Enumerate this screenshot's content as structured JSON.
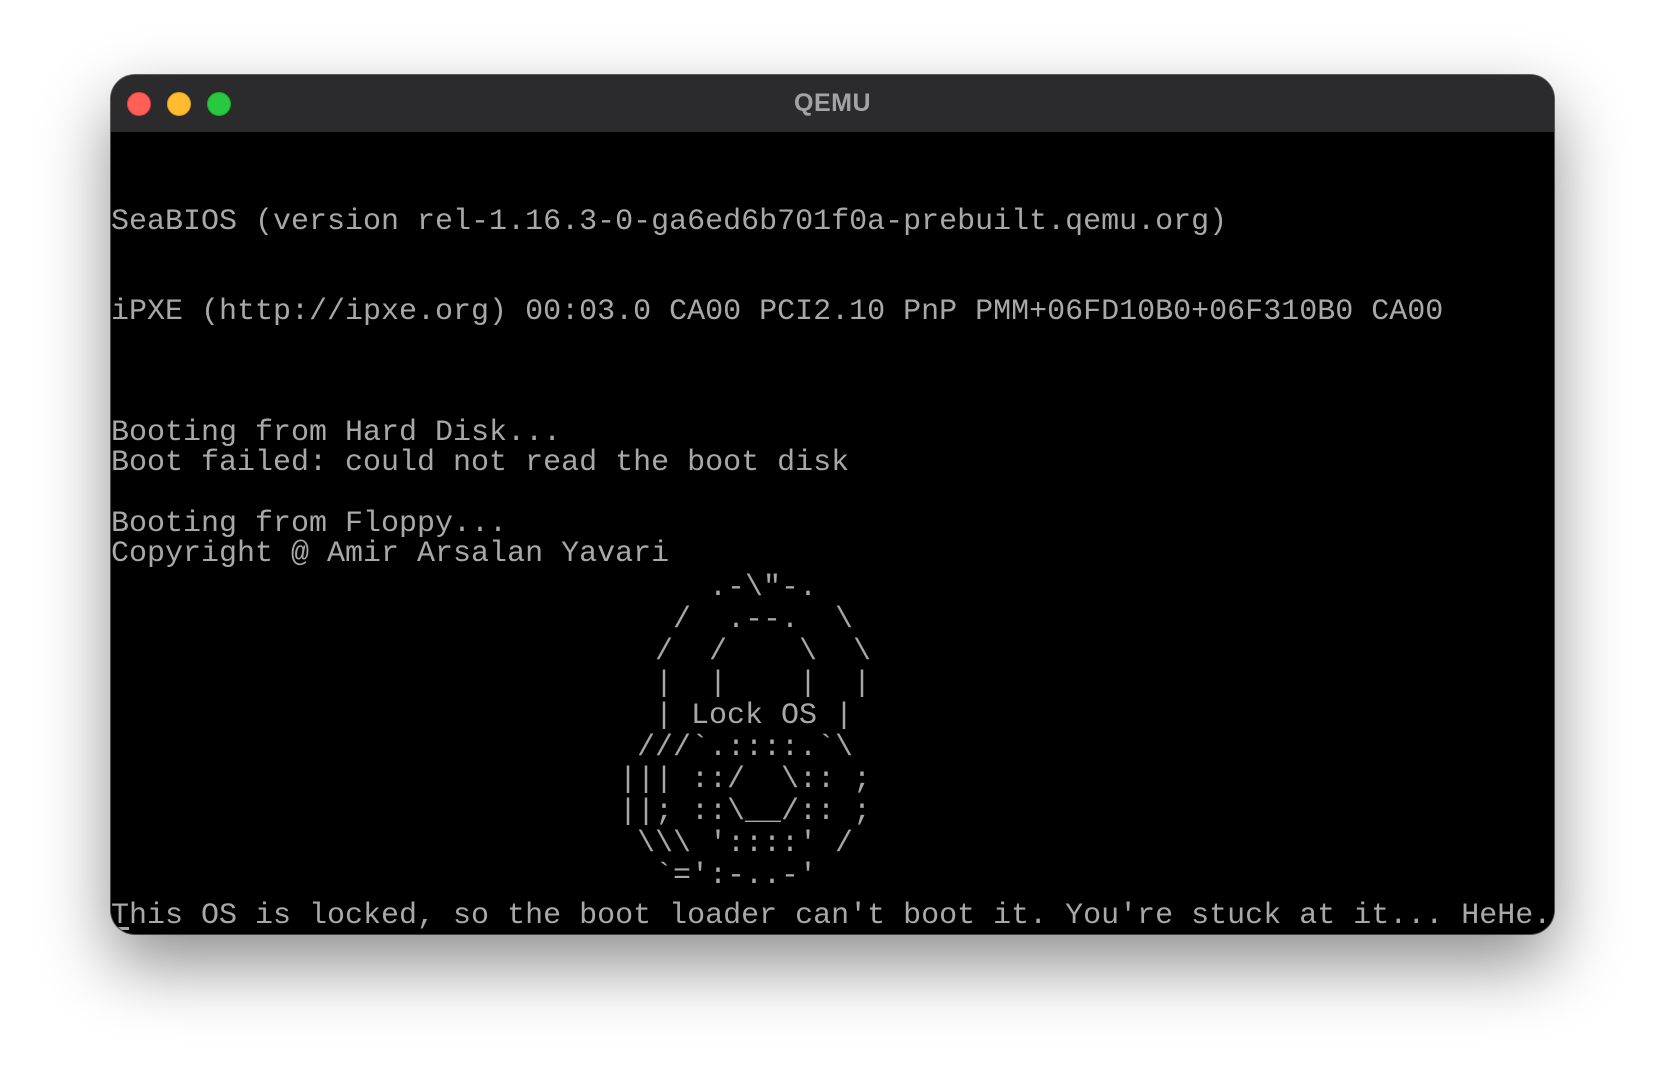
{
  "window": {
    "title": "QEMU"
  },
  "console": {
    "lines": [
      "SeaBIOS (version rel-1.16.3-0-ga6ed6b701f0a-prebuilt.qemu.org)",
      "iPXE (http://ipxe.org) 00:03.0 CA00 PCI2.10 PnP PMM+06FD10B0+06F310B0 CA00",
      "Booting from Hard Disk...",
      "Boot failed: could not read the boot disk",
      "Booting from Floppy...",
      "Copyright @ Amir Arsalan Yavari"
    ],
    "ascii_art": "      .-\\\"-.\n    /  .--.  \\\n   /  /    \\  \\\n   |  |    |  |\n   | Lock OS |\n  ///`.::::.`\\\n ||| ::/  \\:: ;\n ||; ::\\__/:: ;\n  \\\\\\ '::::' /\n   `=':-..-'",
    "message": "This OS is locked, so the boot loader can't boot it. You're stuck at it... HeHe."
  },
  "colors": {
    "text": "#a8a8a8",
    "background": "#000000",
    "titlebar": "#2b2b2d",
    "close": "#fe5f57",
    "minimize": "#febc2e",
    "zoom": "#28c840"
  }
}
